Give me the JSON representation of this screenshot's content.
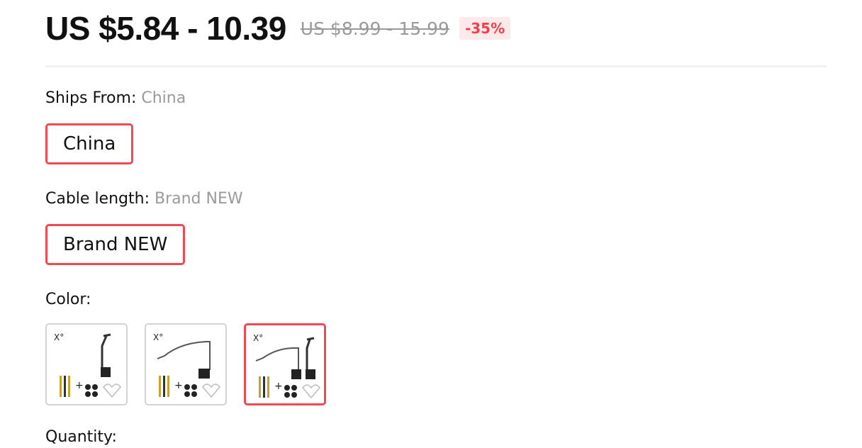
{
  "price": {
    "current": "US $5.84 - 10.39",
    "original": "US $8.99 - 15.99",
    "discount": "-35%"
  },
  "ships_from": {
    "label": "Ships From: ",
    "value": "China",
    "options": [
      "China"
    ]
  },
  "cable_length": {
    "label": "Cable length: ",
    "value": "Brand NEW",
    "options": [
      "Brand NEW"
    ]
  },
  "color": {
    "label": "Color:",
    "swatch_count": 3,
    "selected_index": 2
  },
  "quantity": {
    "label": "Quantity:"
  },
  "colors": {
    "accent": "#ee4a53",
    "discount_bg": "#fde9ea",
    "muted_text": "#9a9a9a"
  }
}
